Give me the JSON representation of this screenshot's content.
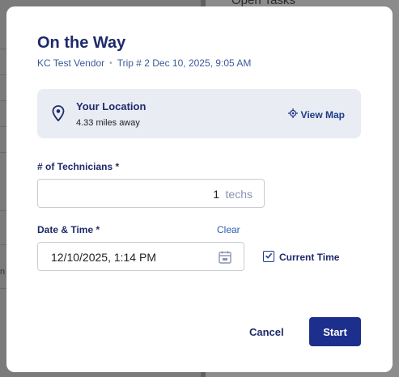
{
  "background": {
    "open_tasks_label": "Open Tasks ",
    "left_edge_text": "n"
  },
  "modal": {
    "title": "On the Way",
    "subtitle": {
      "vendor": "KC Test Vendor",
      "separator": "•",
      "trip": "Trip # 2 Dec 10, 2025, 9:05 AM"
    },
    "location": {
      "title": "Your Location",
      "distance": "4.33 miles away",
      "view_map_label": "View Map",
      "icon": "map-pin-icon"
    },
    "technicians": {
      "label": "# of Technicians *",
      "value": "1",
      "unit": "techs"
    },
    "datetime": {
      "label": "Date & Time *",
      "clear_label": "Clear",
      "value": "12/10/2025, 1:14 PM",
      "icon": "calendar-icon"
    },
    "current_time": {
      "label": "Current Time",
      "checked": true
    },
    "actions": {
      "cancel_label": "Cancel",
      "start_label": "Start"
    }
  },
  "colors": {
    "primary": "#1d2f8c",
    "title": "#1e2a6b",
    "card_bg": "#e9ecf3",
    "link": "#2f5cb0"
  }
}
